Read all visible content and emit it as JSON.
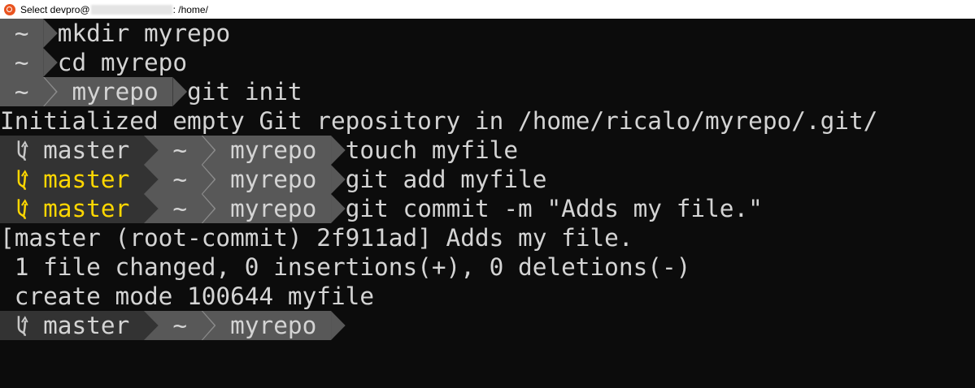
{
  "window": {
    "title_prefix": "Select devpro@",
    "title_suffix": ": /home/"
  },
  "colors": {
    "background": "#0c0c0c",
    "home_segment": "#585858",
    "git_segment": "#333333",
    "dirty_branch": "#ffd700",
    "text": "#d4d4d4"
  },
  "lines": [
    {
      "type": "prompt",
      "home": "~",
      "command": "mkdir myrepo"
    },
    {
      "type": "prompt",
      "home": "~",
      "command": "cd myrepo"
    },
    {
      "type": "prompt",
      "home": "~",
      "dir": "myrepo",
      "command": "git init"
    },
    {
      "type": "output",
      "text": "Initialized empty Git repository in /home/ricalo/myrepo/.git/"
    },
    {
      "type": "prompt",
      "branch": "master",
      "dirty": false,
      "home": "~",
      "dir": "myrepo",
      "command": "touch myfile"
    },
    {
      "type": "prompt",
      "branch": "master",
      "dirty": true,
      "home": "~",
      "dir": "myrepo",
      "command": "git add myfile"
    },
    {
      "type": "prompt",
      "branch": "master",
      "dirty": true,
      "home": "~",
      "dir": "myrepo",
      "command": "git commit -m \"Adds my file.\""
    },
    {
      "type": "output",
      "text": "[master (root-commit) 2f911ad] Adds my file."
    },
    {
      "type": "output",
      "text": " 1 file changed, 0 insertions(+), 0 deletions(-)"
    },
    {
      "type": "output",
      "text": " create mode 100644 myfile"
    },
    {
      "type": "prompt",
      "branch": "master",
      "dirty": false,
      "home": "~",
      "dir": "myrepo",
      "command": ""
    }
  ]
}
